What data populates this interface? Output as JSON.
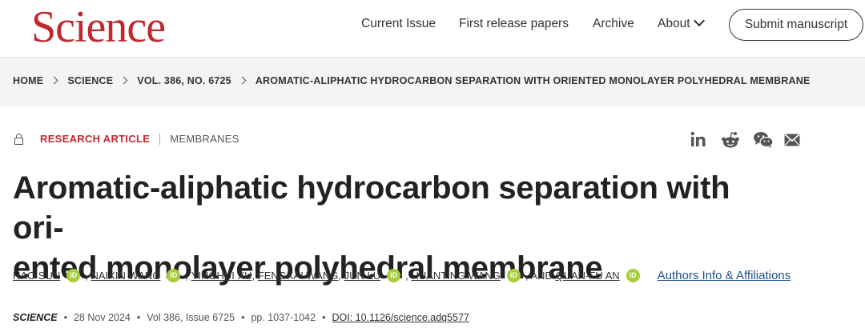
{
  "header": {
    "logo": "Science",
    "nav": [
      "Current Issue",
      "First release papers",
      "Archive",
      "About"
    ],
    "submit_label": "Submit manuscript"
  },
  "breadcrumb": [
    "HOME",
    "SCIENCE",
    "VOL. 386, NO. 6725",
    "AROMATIC-ALIPHATIC HYDROCARBON SEPARATION WITH ORIENTED MONOLAYER POLYHEDRAL MEMBRANE"
  ],
  "article": {
    "type": "RESEARCH ARTICLE",
    "subject": "MEMBRANES",
    "title_line1": "Aromatic-aliphatic hydrocarbon separation with ori-",
    "title_line2": "ented monolayer polyhedral membrane",
    "authors": {
      "a1": "HAO SUN",
      "a2": "NAIXIN WANG",
      "a3": "YINGHUI XU",
      "a4": "FENGKAI WANG",
      "a5": "JUN LU",
      "a6": "HUANTING WANG",
      "a7": "QUAN-FU AN",
      "comma": ",",
      "and": ", AND",
      "affiliations": "Authors Info & Affiliations"
    },
    "citation": {
      "journal": "SCIENCE",
      "date": "28 Nov 2024",
      "volume": "Vol 386, Issue 6725",
      "pages": "pp. 1037-1042",
      "doi": "DOI: 10.1126/science.adq5577"
    }
  },
  "share_icons": [
    "linkedin-icon",
    "reddit-icon",
    "wechat-icon",
    "email-icon"
  ],
  "colors": {
    "brand": "#c1272d",
    "orcid": "#a6ce39",
    "link": "#1e4e8c"
  }
}
